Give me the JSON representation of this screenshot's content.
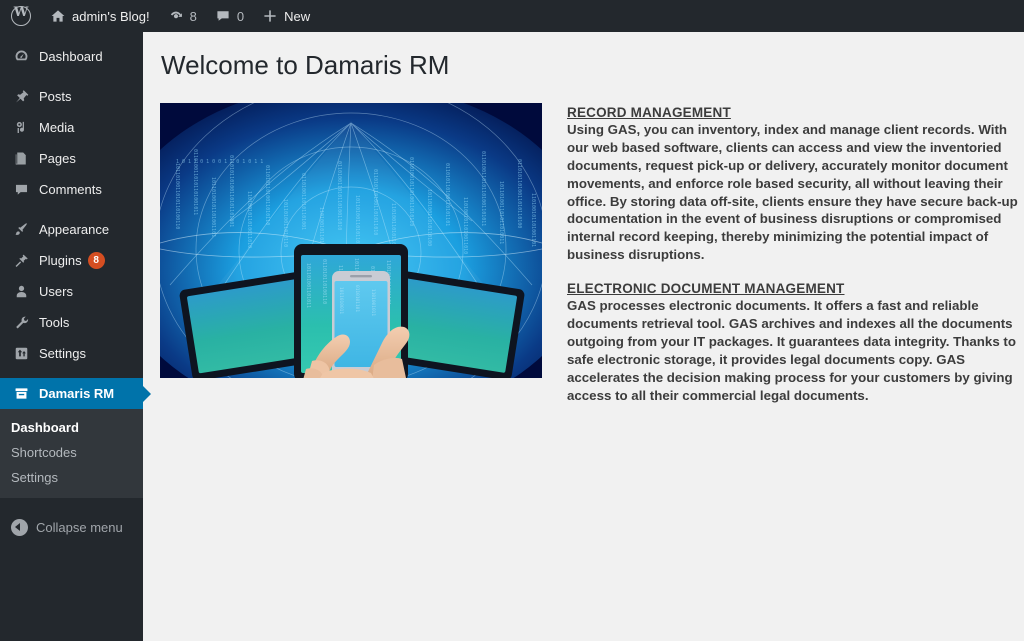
{
  "adminbar": {
    "logo_icon": "wordpress-logo-icon",
    "site": {
      "icon": "home-icon",
      "label": "admin's Blog!"
    },
    "updates": {
      "icon": "updates-icon",
      "count": "8"
    },
    "comments": {
      "icon": "comment-bubble-icon",
      "count": "0"
    },
    "new": {
      "icon": "plus-icon",
      "label": "New"
    }
  },
  "sidebar": {
    "items": [
      {
        "label": "Dashboard",
        "icon": "dashboard-gauge-icon",
        "current": false
      },
      {
        "label": "Posts",
        "icon": "pushpin-icon",
        "current": false
      },
      {
        "label": "Media",
        "icon": "media-note-icon",
        "current": false
      },
      {
        "label": "Pages",
        "icon": "pages-document-icon",
        "current": false
      },
      {
        "label": "Comments",
        "icon": "comment-bubble-icon",
        "current": false
      },
      {
        "label": "Appearance",
        "icon": "paintbrush-icon",
        "current": false
      },
      {
        "label": "Plugins",
        "icon": "plug-icon",
        "current": false,
        "badge": "8"
      },
      {
        "label": "Users",
        "icon": "user-icon",
        "current": false
      },
      {
        "label": "Tools",
        "icon": "wrench-icon",
        "current": false
      },
      {
        "label": "Settings",
        "icon": "settings-sliders-icon",
        "current": false
      },
      {
        "label": "Damaris RM",
        "icon": "archive-box-icon",
        "current": true
      }
    ],
    "submenu": [
      {
        "label": "Dashboard",
        "current": true
      },
      {
        "label": "Shortcodes",
        "current": false
      },
      {
        "label": "Settings",
        "current": false
      }
    ],
    "collapse": {
      "label": "Collapse menu",
      "icon": "collapse-arrow-icon"
    },
    "accent_color": "#0073aa",
    "badge_color": "#d54e21"
  },
  "main": {
    "title": "Welcome to Damaris RM",
    "hero_image": {
      "name": "tablets-and-smartphone-digital-network-illustration",
      "alt": "Blue digital network background with tablets and hands holding a smartphone"
    },
    "sections": [
      {
        "heading": "RECORD MANAGEMENT",
        "body": "Using GAS, you can inventory, index and manage client records. With our web based software, clients can access and view the inventoried documents, request pick-up or delivery, accurately monitor document movements, and enforce role based security, all without leaving their office. By storing data off-site, clients ensure they have secure back-up documentation in the event of business disruptions or compromised internal record keeping, thereby minimizing the potential impact of business disruptions."
      },
      {
        "heading": "ELECTRONIC DOCUMENT MANAGEMENT",
        "body": "GAS processes electronic documents. It offers a fast and reliable documents retrieval tool. GAS archives and indexes all the documents outgoing from your IT packages. It guarantees data integrity. Thanks to safe electronic storage, it provides legal documents copy. GAS accelerates the decision making process for your customers by giving access to all their commercial legal documents."
      }
    ]
  }
}
